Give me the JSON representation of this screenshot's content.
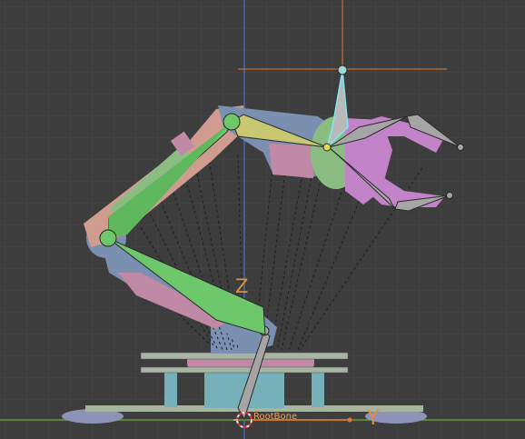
{
  "viewport": {
    "root_bone_label": "RootBone",
    "axis_y_label": "Y",
    "axis_z_label": "Z"
  },
  "colors": {
    "background": "#3d3d3d",
    "grid": "#474747",
    "axis_green": "#6b9a3c",
    "axis_blue": "#3f6fb1",
    "selection_orange": "#e8792b",
    "bone_green": "#6cc86a",
    "bone_gray": "#a5a5a5",
    "bone_yellow": "#c8c873",
    "bone_selected_outline": "#7fe7ef",
    "mesh_blue": "#7b8fb0",
    "mesh_pink": "#c08aa6",
    "mesh_purple": "#c383c8",
    "mesh_teal": "#76b0b8"
  }
}
